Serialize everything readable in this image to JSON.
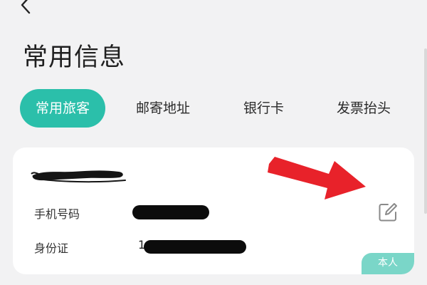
{
  "header": {
    "title": "常用信息",
    "back_icon": "chevron-left-icon"
  },
  "tabs": [
    {
      "label": "常用旅客",
      "active": true
    },
    {
      "label": "邮寄地址",
      "active": false
    },
    {
      "label": "银行卡",
      "active": false
    },
    {
      "label": "发票抬头",
      "active": false
    }
  ],
  "card": {
    "phone_label": "手机号码",
    "id_label": "身份证",
    "id_visible_prefix": "1",
    "badge": "本人",
    "edit_icon": "edit-icon"
  },
  "colors": {
    "accent": "#2bbfaa",
    "badge": "#7ad6c8",
    "annotation": "#e8222a",
    "background": "#f2f2f3"
  }
}
